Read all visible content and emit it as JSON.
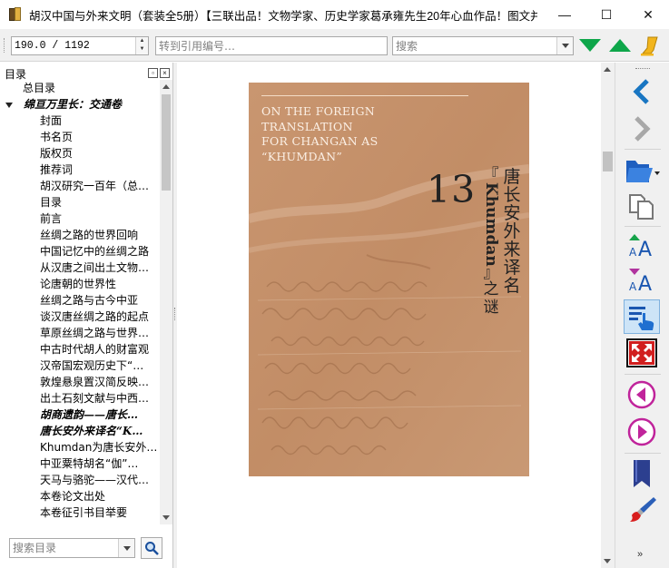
{
  "window": {
    "title": "胡汉中国与外来文明（套装全5册）【三联出品！文物学家、历史学家葛承雍先生20年心血作品！图文并…",
    "controls": {
      "minimize": "—",
      "maximize": "☐",
      "close": "✕"
    }
  },
  "toolbar": {
    "page_value": "190.0 / 1192",
    "ref_placeholder": "转到引用编号…",
    "search_placeholder": "搜索",
    "next_result_icon": "triangle-down-green",
    "prev_result_icon": "triangle-up-green",
    "highlight_icon": "yellow-highlighter"
  },
  "toc": {
    "header_label": "目录",
    "items": [
      {
        "label": "总目录",
        "level": 0,
        "bold": false
      },
      {
        "label": "绵亘万里长：交通卷",
        "level": 0,
        "bold": true,
        "expanded": true
      },
      {
        "label": "封面",
        "level": 1,
        "bold": false
      },
      {
        "label": "书名页",
        "level": 1,
        "bold": false
      },
      {
        "label": "版权页",
        "level": 1,
        "bold": false
      },
      {
        "label": "推荐词",
        "level": 1,
        "bold": false
      },
      {
        "label": "胡汉研究一百年（总…",
        "level": 1,
        "bold": false
      },
      {
        "label": "目录",
        "level": 1,
        "bold": false
      },
      {
        "label": "前言",
        "level": 1,
        "bold": false
      },
      {
        "label": "丝绸之路的世界回响",
        "level": 1,
        "bold": false
      },
      {
        "label": "中国记忆中的丝绸之路",
        "level": 1,
        "bold": false
      },
      {
        "label": "从汉唐之间出土文物…",
        "level": 1,
        "bold": false
      },
      {
        "label": "论唐朝的世界性",
        "level": 1,
        "bold": false
      },
      {
        "label": "丝绸之路与古今中亚",
        "level": 1,
        "bold": false
      },
      {
        "label": "谈汉唐丝绸之路的起点",
        "level": 1,
        "bold": false
      },
      {
        "label": "草原丝绸之路与世界…",
        "level": 1,
        "bold": false
      },
      {
        "label": "中古时代胡人的财富观",
        "level": 1,
        "bold": false
      },
      {
        "label": "汉帝国宏观历史下“…",
        "level": 1,
        "bold": false
      },
      {
        "label": "敦煌悬泉置汉简反映…",
        "level": 1,
        "bold": false
      },
      {
        "label": "出土石刻文献与中西…",
        "level": 1,
        "bold": false
      },
      {
        "label": "胡商遗韵——唐长…",
        "level": 1,
        "bold": true
      },
      {
        "label": "唐长安外来译名“K…",
        "level": 1,
        "bold": true
      },
      {
        "label": "Khumdan为唐长安外…",
        "level": 1,
        "bold": false
      },
      {
        "label": "中亚粟特胡名“伽”…",
        "level": 1,
        "bold": false
      },
      {
        "label": "天马与骆驼——汉代…",
        "level": 1,
        "bold": false
      },
      {
        "label": "本卷论文出处",
        "level": 1,
        "bold": false
      },
      {
        "label": "本卷征引书目举要",
        "level": 1,
        "bold": false
      }
    ],
    "search_placeholder": "搜索目录"
  },
  "page": {
    "en_title": [
      "ON THE FOREIGN",
      "TRANSLATION",
      "FOR CHANGAN AS",
      "“KHUMDAN”"
    ],
    "chapter_number": "13",
    "cn_title_chars": [
      "唐",
      "长",
      "安",
      "外",
      "来",
      "译",
      "名"
    ],
    "cn_sub_open": "『",
    "cn_sub_word": "Khumdan",
    "cn_sub_close": "』",
    "cn_sub_rest": [
      "之",
      "谜"
    ],
    "bg_color": "#c4906a"
  },
  "right_toolbar": {
    "icons": [
      "back-arrow-icon",
      "forward-arrow-icon",
      "open-folder-icon",
      "copy-pages-icon",
      "increase-font-icon",
      "decrease-font-icon",
      "select-tool-icon",
      "fullscreen-icon",
      "previous-page-icon",
      "next-page-icon",
      "bookmark-icon",
      "paint-brush-icon"
    ],
    "more_label": "»"
  }
}
